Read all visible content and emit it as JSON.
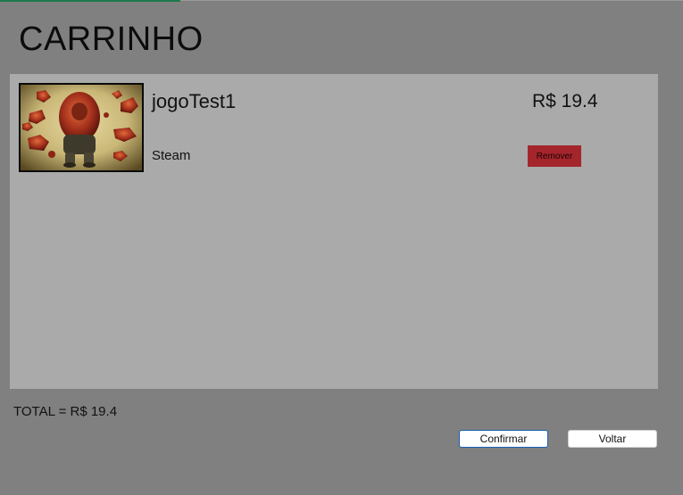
{
  "page": {
    "title": "CARRINHO"
  },
  "cart": {
    "items": [
      {
        "title": "jogoTest1",
        "platform": "Steam",
        "price": "R$ 19.4",
        "remove_label": "Remover",
        "thumbnail_icon": "game-cover-image"
      }
    ]
  },
  "footer": {
    "total": "TOTAL = R$ 19.4",
    "confirm_label": "Confirmar",
    "back_label": "Voltar"
  },
  "colors": {
    "background": "#808080",
    "panel": "#aaaaaa",
    "remove_button": "#a4262c",
    "confirm_border": "#1a5fb4",
    "top_accent": "#1e7a4a"
  }
}
